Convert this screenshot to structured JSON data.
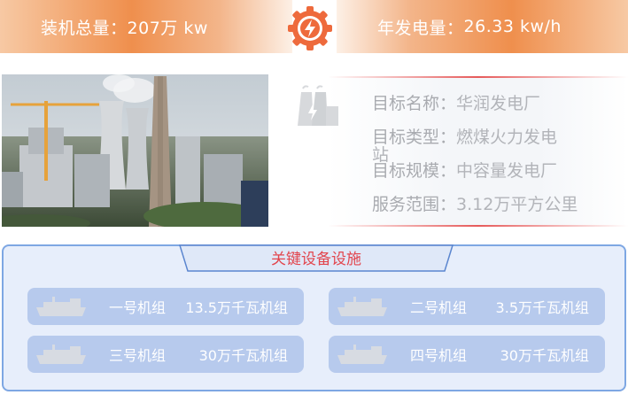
{
  "stats": {
    "capacity_label": "装机总量：",
    "capacity_value": "207万 kw",
    "generation_label": "年发电量：",
    "generation_value": "26.33 kw/h"
  },
  "info": {
    "name_label": "目标名称：",
    "name_value": "华润发电厂",
    "type_label": "目标类型：",
    "type_value": "燃煤火力发电",
    "type_value_wrap": "站",
    "scale_label": "目标规模：",
    "scale_value": "中容量发电厂",
    "range_label": "服务范围：",
    "range_value": "3.12万平方公里"
  },
  "equipment": {
    "title": "关键设备设施",
    "units": [
      {
        "name": "一号机组",
        "capacity": "13.5万千瓦机组"
      },
      {
        "name": "二号机组",
        "capacity": "3.5万千瓦机组"
      },
      {
        "name": "三号机组",
        "capacity": "30万千瓦机组"
      },
      {
        "name": "四号机组",
        "capacity": "30万千瓦机组"
      }
    ]
  },
  "colors": {
    "accent_orange": "#ef8f4d",
    "accent_red": "#e2454d",
    "panel_border": "#7ea7e3",
    "unit_bg": "#b7caed"
  },
  "icons": {
    "center": "power-bolt-gear-icon",
    "plant": "power-plant-icon",
    "unit": "ship-icon"
  }
}
